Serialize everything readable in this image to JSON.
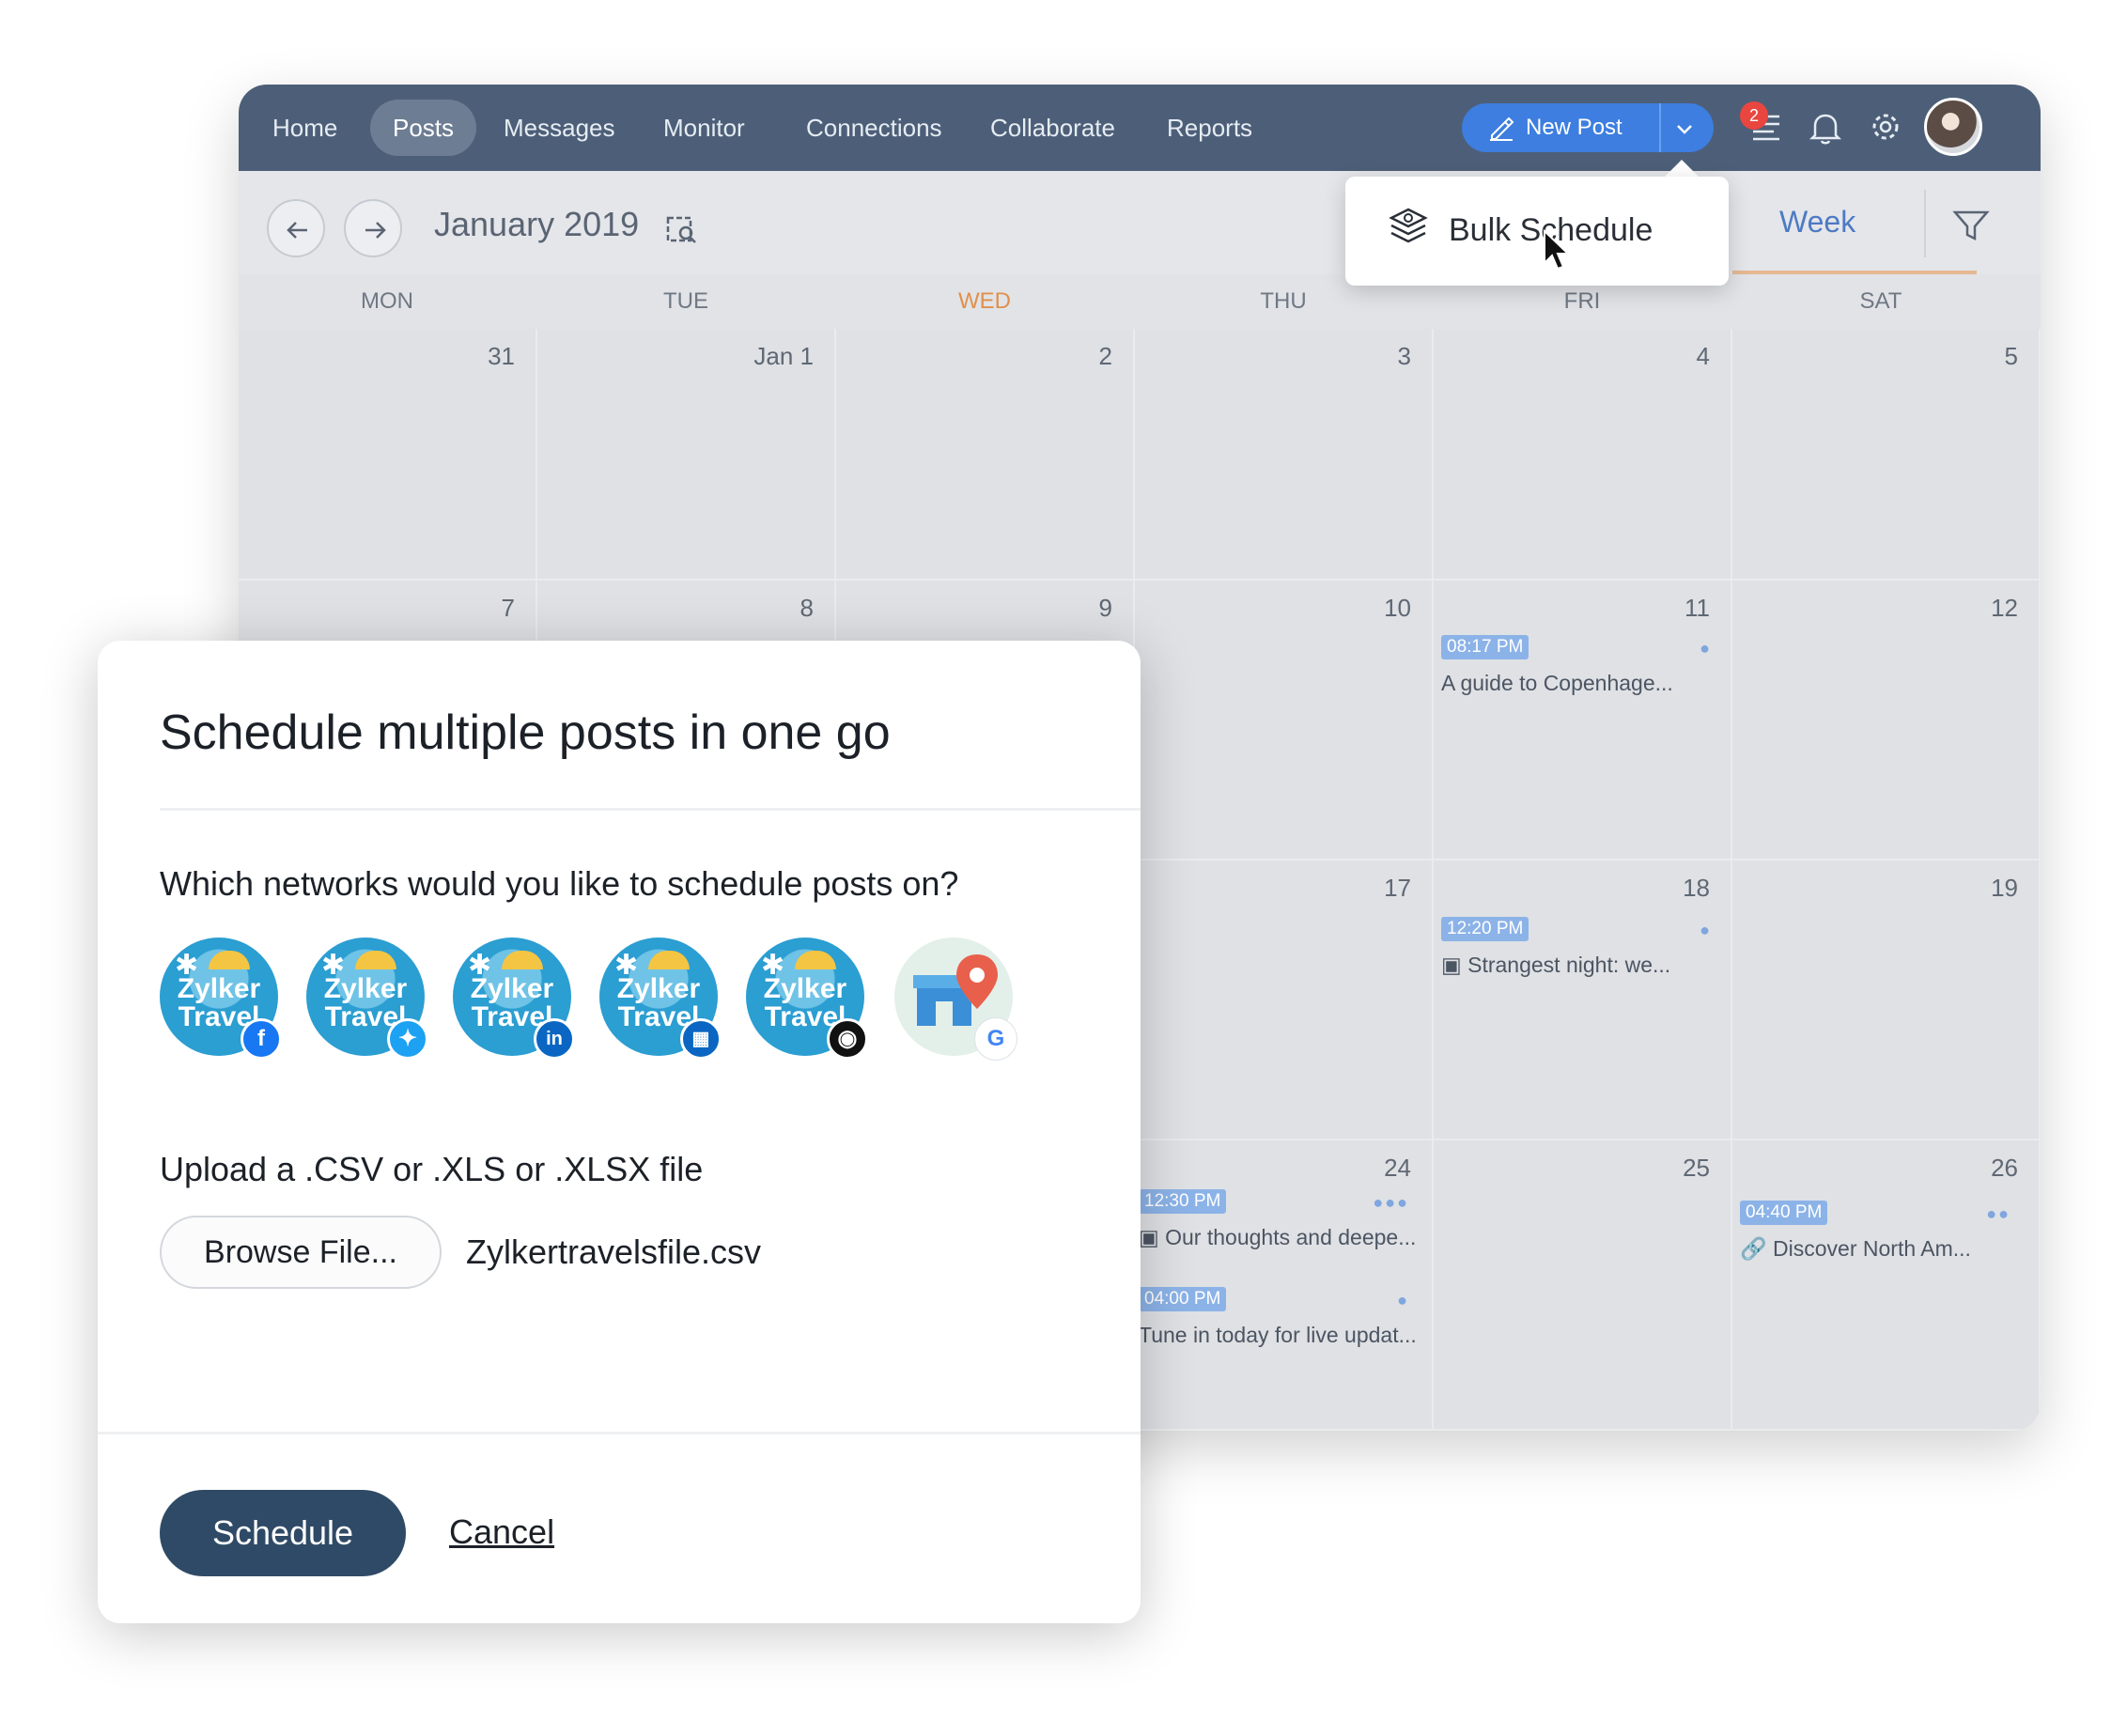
{
  "nav": {
    "items": [
      "Home",
      "Posts",
      "Messages",
      "Monitor",
      "Connections",
      "Collaborate",
      "Reports"
    ],
    "active": "Posts",
    "new_post_label": "New Post",
    "notification_count": "2"
  },
  "calendar": {
    "month_label": "January 2019",
    "view_label": "Week",
    "days": [
      "MON",
      "TUE",
      "WED",
      "THU",
      "FRI",
      "SAT"
    ],
    "today": "WED",
    "weeks": [
      [
        "31",
        "Jan 1",
        "2",
        "3",
        "4",
        "5"
      ],
      [
        "7",
        "8",
        "9",
        "10",
        "11",
        "12"
      ],
      [
        "",
        "",
        "",
        "17",
        "18",
        "19"
      ],
      [
        "",
        "",
        "",
        "24",
        "25",
        "26"
      ]
    ],
    "posts": {
      "fri11": {
        "time": "08:17 PM",
        "text": "A guide to Copenhage..."
      },
      "fri18": {
        "time": "12:20 PM",
        "text": "Strangest night: we..."
      },
      "thu24a": {
        "time": "12:30 PM",
        "text": "Our thoughts and deepe..."
      },
      "thu24b": {
        "time": "04:00 PM",
        "text": "Tune in today for live updat..."
      },
      "sat26": {
        "time": "04:40 PM",
        "text": "Discover North Am..."
      }
    }
  },
  "dropdown": {
    "item_label": "Bulk Schedule"
  },
  "modal": {
    "title": "Schedule multiple posts in one go",
    "question": "Which networks would you like to schedule posts on?",
    "brand_line1": "Zylker",
    "brand_line2": "Travel",
    "networks": [
      "facebook",
      "twitter",
      "linkedin",
      "linkedin-page",
      "instagram",
      "google-my-business"
    ],
    "network_colors": {
      "facebook": "#1877f2",
      "twitter": "#1da1f2",
      "linkedin": "#0a66c2",
      "linkedin-page": "#0a66c2",
      "instagram": "#111111",
      "google": "#4285f4"
    },
    "upload_label": "Upload a .CSV or .XLS or .XLSX file",
    "browse_label": "Browse File...",
    "file_name": "Zylkertravelsfile.csv",
    "schedule_label": "Schedule",
    "cancel_label": "Cancel"
  }
}
